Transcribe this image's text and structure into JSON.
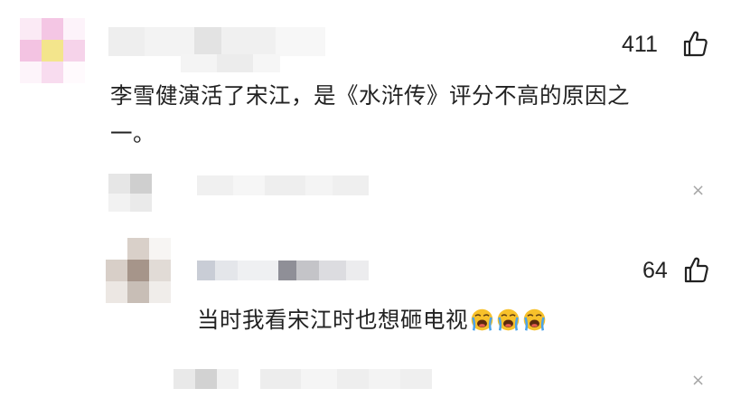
{
  "comment_main": {
    "like_count": "411",
    "text_line1": "李雪健演活了宋江，是《水浒传》评分不高的原因之",
    "text_line2": "一。"
  },
  "reply_1": {
    "close_label": "×"
  },
  "reply_2": {
    "like_count": "64",
    "text": "当时我看宋江时也想砸电视"
  },
  "reply_3": {
    "close_label": "×"
  },
  "icons": {
    "like": "thumbs-up-icon",
    "emoji": "loudly-crying-face-icon",
    "close": "close-icon"
  },
  "colors": {
    "text": "#222222",
    "muted_icon": "#a6a6a6",
    "emoji_face": "#f7c12b",
    "emoji_tears": "#4aa3ea"
  }
}
